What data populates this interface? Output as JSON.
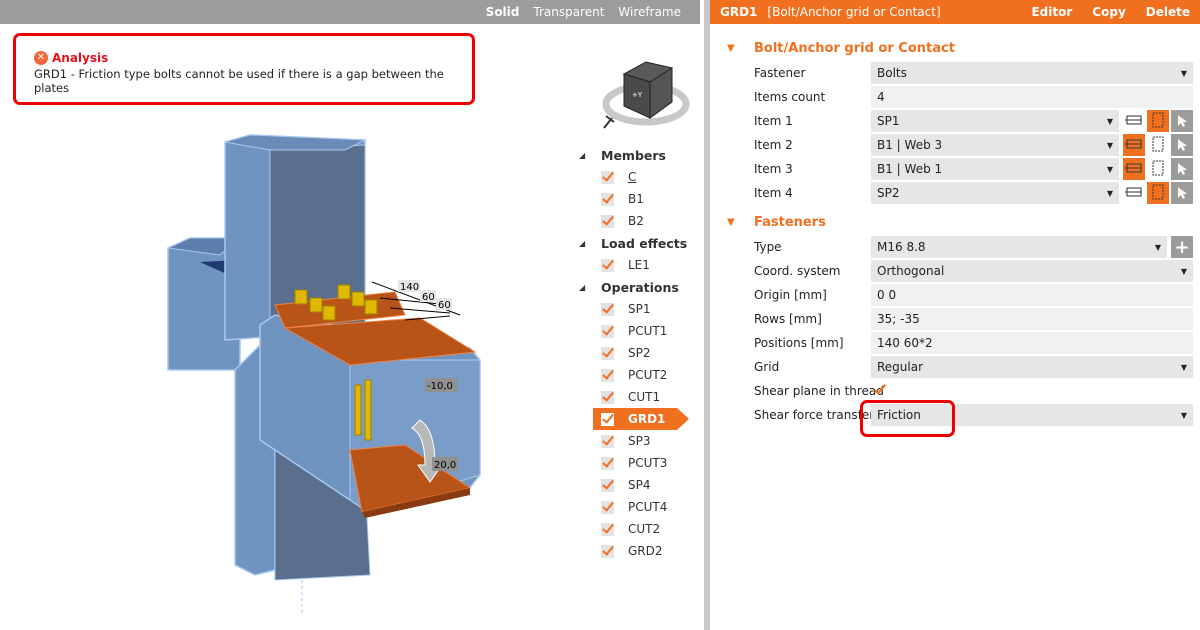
{
  "viewport": {
    "view_modes": [
      "Solid",
      "Transparent",
      "Wireframe"
    ],
    "active_mode": "Solid",
    "alert": {
      "title": "Analysis",
      "message": "GRD1 - Friction type bolts cannot be used if there is a gap between the plates",
      "icon": "error-icon"
    },
    "navcube": {
      "face_label": "+Y"
    },
    "model_labels": {
      "dim_1": "140",
      "dim_2": "60",
      "dim_3": "60",
      "load_1": "-10,0",
      "load_2": "20,0"
    }
  },
  "tree": {
    "groups": [
      {
        "label": "Members",
        "items": [
          {
            "label": "C",
            "checked": true,
            "underline": true
          },
          {
            "label": "B1",
            "checked": true
          },
          {
            "label": "B2",
            "checked": true
          }
        ]
      },
      {
        "label": "Load effects",
        "items": [
          {
            "label": "LE1",
            "checked": true
          }
        ]
      },
      {
        "label": "Operations",
        "items": [
          {
            "label": "SP1",
            "checked": true
          },
          {
            "label": "PCUT1",
            "checked": true
          },
          {
            "label": "SP2",
            "checked": true
          },
          {
            "label": "PCUT2",
            "checked": true
          },
          {
            "label": "CUT1",
            "checked": true
          },
          {
            "label": "GRD1",
            "checked": true,
            "selected": true
          },
          {
            "label": "SP3",
            "checked": true
          },
          {
            "label": "PCUT3",
            "checked": true
          },
          {
            "label": "SP4",
            "checked": true
          },
          {
            "label": "PCUT4",
            "checked": true
          },
          {
            "label": "CUT2",
            "checked": true
          },
          {
            "label": "GRD2",
            "checked": true
          }
        ]
      }
    ]
  },
  "panel": {
    "header": {
      "id": "GRD1",
      "type": "[Bolt/Anchor grid or Contact]",
      "buttons": [
        "Editor",
        "Copy",
        "Delete"
      ]
    },
    "section1": {
      "title": "Bolt/Anchor grid or Contact",
      "fastener_label": "Fastener",
      "fastener_value": "Bolts",
      "items_count_label": "Items count",
      "items_count_value": "4",
      "items": [
        {
          "label": "Item 1",
          "value": "SP1",
          "mode": "plate"
        },
        {
          "label": "Item 2",
          "value": "B1 | Web 3",
          "mode": "member"
        },
        {
          "label": "Item 3",
          "value": "B1 | Web 1",
          "mode": "member"
        },
        {
          "label": "Item 4",
          "value": "SP2",
          "mode": "plate"
        }
      ]
    },
    "section2": {
      "title": "Fasteners",
      "type_label": "Type",
      "type_value": "M16 8.8",
      "coord_label": "Coord. system",
      "coord_value": "Orthogonal",
      "origin_label": "Origin [mm]",
      "origin_value": "0 0",
      "rows_label": "Rows [mm]",
      "rows_value": "35; -35",
      "positions_label": "Positions [mm]",
      "positions_value": "140 60*2",
      "grid_label": "Grid",
      "grid_value": "Regular",
      "shear_thread_label": "Shear plane in thread",
      "shear_thread_checked": true,
      "shear_transfer_label": "Shear force transfer",
      "shear_transfer_value": "Friction"
    }
  },
  "colors": {
    "accent": "#f07020",
    "error": "#ee0000",
    "toolbar": "#9c9c9c",
    "member_blue": "#7094c0",
    "plate_orange": "#b85418",
    "bolt_yellow": "#e0b800"
  }
}
